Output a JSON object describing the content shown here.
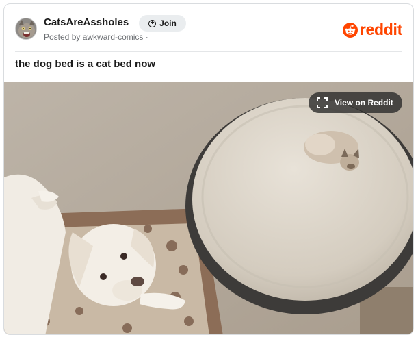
{
  "post": {
    "subreddit": "CatsAreAssholes",
    "posted_by_prefix": "Posted by",
    "author": "awkward-comics",
    "separator": "·",
    "title": "the dog bed is a cat bed now"
  },
  "actions": {
    "join_label": "Join",
    "view_label": "View on Reddit"
  },
  "brand": {
    "logo_text": "reddit",
    "color": "#ff4500"
  },
  "icons": {
    "join": "plus-circle-icon",
    "view": "expand-icon",
    "logo": "reddit-snoo-icon"
  },
  "media": {
    "description_free": true
  }
}
